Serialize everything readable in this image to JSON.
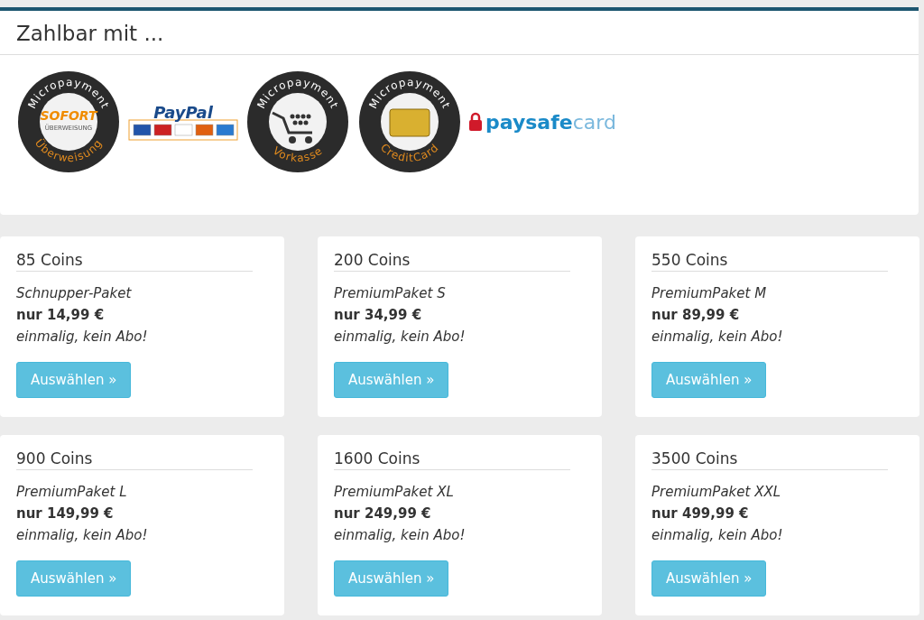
{
  "payment": {
    "title": "Zahlbar mit ...",
    "logos": [
      {
        "kind": "sofort-badge",
        "top": "Micropayment",
        "bottom": "Überweisung",
        "inner_lines": [
          "SOFORT",
          "ÜBERWEISUNG"
        ]
      },
      {
        "kind": "paypal",
        "name": "PayPal"
      },
      {
        "kind": "cart-badge",
        "top": "Micropayment",
        "bottom": "Vorkasse"
      },
      {
        "kind": "card-badge",
        "top": "Micropayment",
        "bottom": "CreditCard"
      },
      {
        "kind": "paysafe",
        "name": "paysafe",
        "suffix": "card"
      }
    ]
  },
  "packages": [
    {
      "coins": "85 Coins",
      "name": "Schnupper-Paket",
      "price": "nur 14,99 €",
      "note": "einmalig, kein Abo!",
      "button": "Auswählen »"
    },
    {
      "coins": "200 Coins",
      "name": "PremiumPaket S",
      "price": "nur 34,99 €",
      "note": "einmalig, kein Abo!",
      "button": "Auswählen »"
    },
    {
      "coins": "550 Coins",
      "name": "PremiumPaket M",
      "price": "nur 89,99 €",
      "note": "einmalig, kein Abo!",
      "button": "Auswählen »"
    },
    {
      "coins": "900 Coins",
      "name": "PremiumPaket L",
      "price": "nur 149,99 €",
      "note": "einmalig, kein Abo!",
      "button": "Auswählen »"
    },
    {
      "coins": "1600 Coins",
      "name": "PremiumPaket XL",
      "price": "nur 249,99 €",
      "note": "einmalig, kein Abo!",
      "button": "Auswählen »"
    },
    {
      "coins": "3500 Coins",
      "name": "PremiumPaket XXL",
      "price": "nur 499,99 €",
      "note": "einmalig, kein Abo!",
      "button": "Auswählen »"
    }
  ]
}
